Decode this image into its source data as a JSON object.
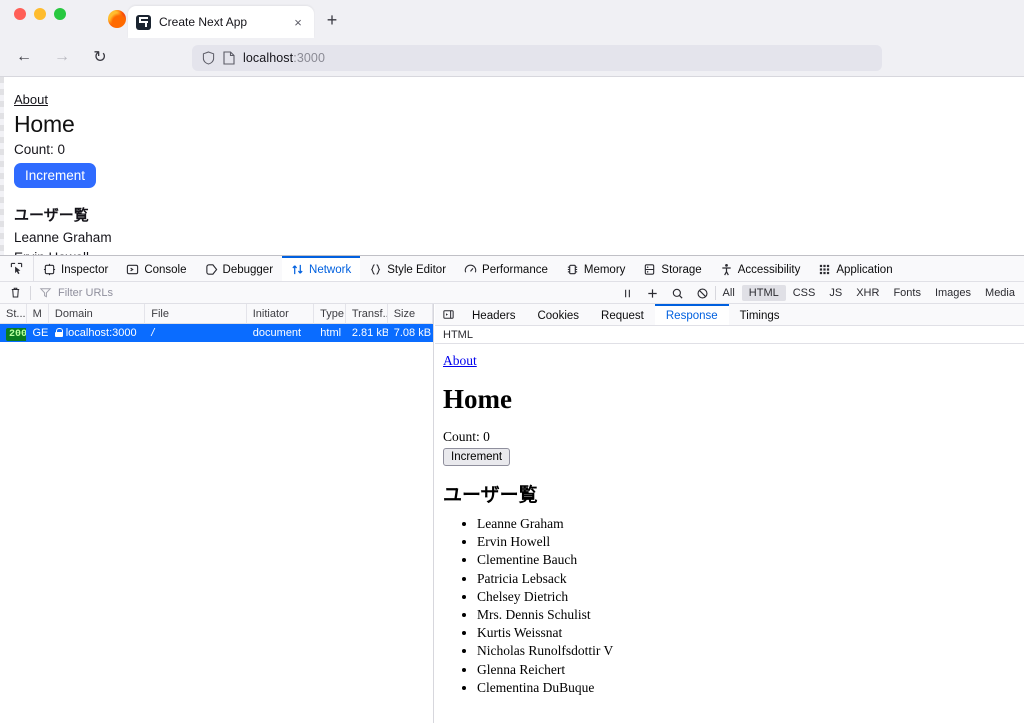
{
  "browser": {
    "window_controls": [
      "close",
      "minimize",
      "maximize"
    ],
    "logo": "firefox-logo",
    "tab": {
      "title": "Create Next App",
      "favicon": "nextjs-favicon",
      "close": "×"
    },
    "new_tab_label": "+",
    "nav": {
      "back": "←",
      "forward": "→",
      "reload": "↻"
    },
    "urlbar": {
      "host": "localhost",
      "port": ":3000",
      "shield_icon": "shield-icon",
      "page_icon": "page-icon"
    }
  },
  "viewport": {
    "about_link": "About",
    "title": "Home",
    "count_text": "Count: 0",
    "increment_label": "Increment",
    "users_heading": "ユーザー覧",
    "users": [
      "Leanne Graham",
      "Ervin Howell"
    ],
    "accent": "#2f6bff"
  },
  "devtools": {
    "picker_icon": "element-picker-icon",
    "tabs": [
      {
        "label": "Inspector",
        "icon": "inspector-icon",
        "active": false
      },
      {
        "label": "Console",
        "icon": "console-icon",
        "active": false
      },
      {
        "label": "Debugger",
        "icon": "debugger-icon",
        "active": false
      },
      {
        "label": "Network",
        "icon": "network-icon",
        "active": true
      },
      {
        "label": "Style Editor",
        "icon": "style-editor-icon",
        "active": false
      },
      {
        "label": "Performance",
        "icon": "performance-icon",
        "active": false
      },
      {
        "label": "Memory",
        "icon": "memory-icon",
        "active": false
      },
      {
        "label": "Storage",
        "icon": "storage-icon",
        "active": false
      },
      {
        "label": "Accessibility",
        "icon": "accessibility-icon",
        "active": false
      },
      {
        "label": "Application",
        "icon": "application-icon",
        "active": false
      }
    ],
    "filterbar": {
      "trash_icon": "trash-icon",
      "filter_placeholder": "Filter URLs",
      "filter_value": "",
      "pause_icon": "pause-icon",
      "add_icon": "plus-icon",
      "search_icon": "search-icon",
      "block_icon": "block-icon",
      "types": [
        {
          "label": "All",
          "active": false
        },
        {
          "label": "HTML",
          "active": true
        },
        {
          "label": "CSS",
          "active": false
        },
        {
          "label": "JS",
          "active": false
        },
        {
          "label": "XHR",
          "active": false
        },
        {
          "label": "Fonts",
          "active": false
        },
        {
          "label": "Images",
          "active": false
        },
        {
          "label": "Media",
          "active": false
        }
      ]
    },
    "network_table": {
      "columns": [
        "St...",
        "M",
        "Domain",
        "File",
        "Initiator",
        "Type",
        "Transf...",
        "Size"
      ],
      "rows": [
        {
          "status": "200",
          "method": "GE",
          "domain": "localhost:3000",
          "file": "/",
          "initiator": "document",
          "type": "html",
          "transferred": "2.81 kB",
          "size": "7.08 kB",
          "secure": true,
          "selected": true
        }
      ]
    },
    "details": {
      "toggle_icon": "panel-toggle-icon",
      "tabs": [
        {
          "label": "Headers",
          "active": false
        },
        {
          "label": "Cookies",
          "active": false
        },
        {
          "label": "Request",
          "active": false
        },
        {
          "label": "Response",
          "active": true
        },
        {
          "label": "Timings",
          "active": false
        }
      ],
      "subbar_label": "HTML",
      "preview": {
        "about_link": "About",
        "title": "Home",
        "count_text": "Count: 0",
        "increment_label": "Increment",
        "users_heading": "ユーザー覧",
        "users": [
          "Leanne Graham",
          "Ervin Howell",
          "Clementine Bauch",
          "Patricia Lebsack",
          "Chelsey Dietrich",
          "Mrs. Dennis Schulist",
          "Kurtis Weissnat",
          "Nicholas Runolfsdottir V",
          "Glenna Reichert",
          "Clementina DuBuque"
        ]
      }
    }
  },
  "colors": {
    "selection_blue": "#0a6cff",
    "active_tab_blue": "#0060df",
    "status_green_bg": "#0a7c1f",
    "status_green_fg": "#b8ff9e"
  }
}
